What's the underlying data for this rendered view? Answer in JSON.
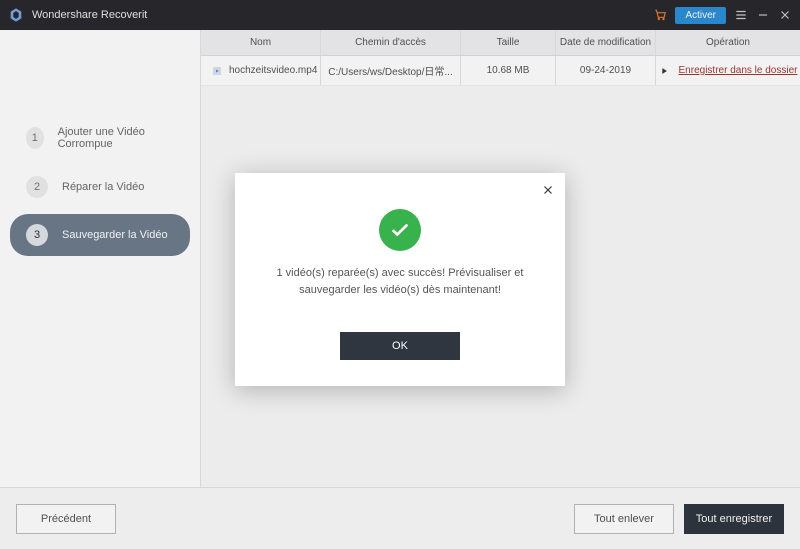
{
  "titlebar": {
    "app_title": "Wondershare Recoverit",
    "activate_label": "Activer"
  },
  "sidebar": {
    "steps": [
      {
        "num": "1",
        "label": "Ajouter une Vidéo Corrompue"
      },
      {
        "num": "2",
        "label": "Réparer la Vidéo"
      },
      {
        "num": "3",
        "label": "Sauvegarder la Vidéo"
      }
    ]
  },
  "table": {
    "headers": {
      "name": "Nom",
      "path": "Chemin d'accès",
      "size": "Taille",
      "date": "Date de modification",
      "op": "Opération"
    },
    "rows": [
      {
        "name": "hochzeitsvideo.mp4",
        "path": "C:/Users/ws/Desktop/日常...",
        "size": "10.68 MB",
        "date": "09-24-2019",
        "op_link": "Enregistrer dans le dossier"
      }
    ]
  },
  "footer": {
    "prev": "Précédent",
    "remove_all": "Tout enlever",
    "save_all": "Tout enregistrer"
  },
  "modal": {
    "message": "1 vidéo(s) reparée(s) avec succès! Prévisualiser et sauvegarder les vidéo(s) dès maintenant!",
    "ok": "OK"
  }
}
